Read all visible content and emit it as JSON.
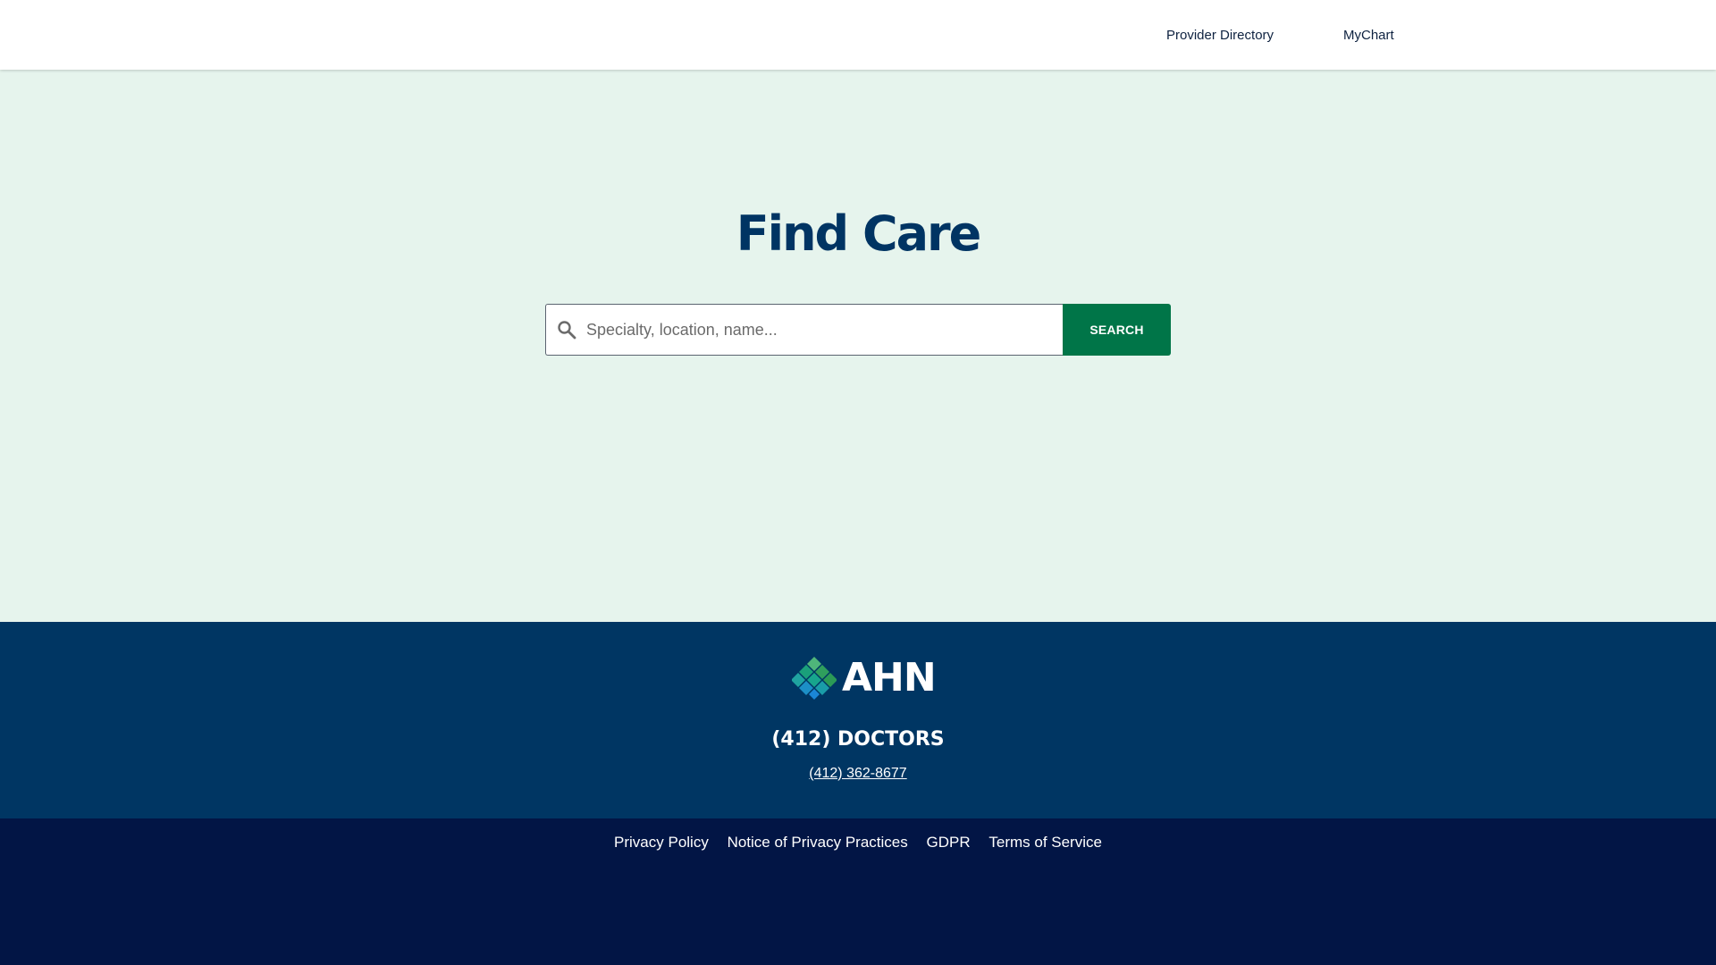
{
  "nav": {
    "links": [
      {
        "label": "Provider Directory"
      },
      {
        "label": "MyChart"
      }
    ]
  },
  "hero": {
    "title": "Find Care",
    "search": {
      "placeholder": "Specialty, location, name...",
      "value": "",
      "button_label": "SEARCH",
      "icon": "search-icon"
    }
  },
  "footer": {
    "logo_text": "AHN",
    "phone_name": "(412) DOCTORS",
    "phone_number": "(412) 362-8677",
    "legal_links": [
      {
        "label": "Privacy Policy"
      },
      {
        "label": "Notice of Privacy Practices"
      },
      {
        "label": "GDPR"
      },
      {
        "label": "Terms of Service"
      }
    ]
  },
  "colors": {
    "hero_bg": "#e6f4ed",
    "title": "#003463",
    "search_button": "#007548",
    "footer_main": "#003663",
    "footer_legal": "#021545"
  }
}
